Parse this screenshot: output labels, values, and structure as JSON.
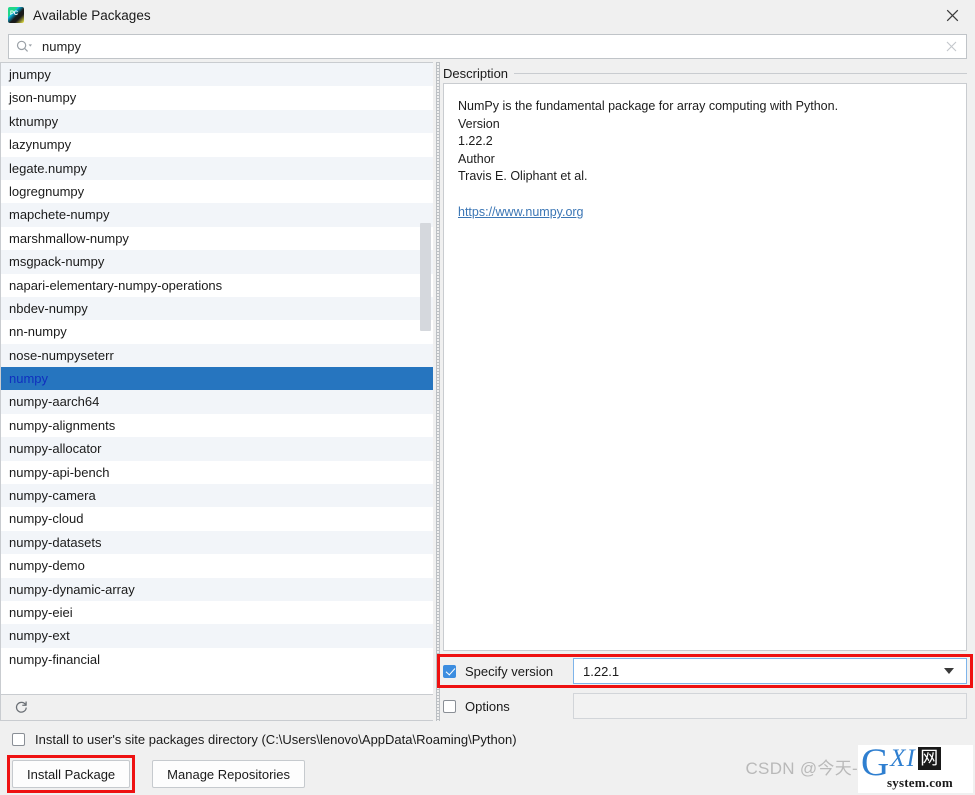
{
  "window": {
    "title": "Available Packages",
    "app_icon": "pycharm-icon",
    "close_icon": "close-icon"
  },
  "search": {
    "value": "numpy",
    "placeholder": "",
    "icon": "search-icon",
    "clear_icon": "clear-icon"
  },
  "package_list": {
    "items": [
      "jnumpy",
      "json-numpy",
      "ktnumpy",
      "lazynumpy",
      "legate.numpy",
      "logregnumpy",
      "mapchete-numpy",
      "marshmallow-numpy",
      "msgpack-numpy",
      "napari-elementary-numpy-operations",
      "nbdev-numpy",
      "nn-numpy",
      "nose-numpyseterr",
      "numpy",
      "numpy-aarch64",
      "numpy-alignments",
      "numpy-allocator",
      "numpy-api-bench",
      "numpy-camera",
      "numpy-cloud",
      "numpy-datasets",
      "numpy-demo",
      "numpy-dynamic-array",
      "numpy-eiei",
      "numpy-ext",
      "numpy-financial"
    ],
    "selected_index": 13,
    "selected_value": "numpy",
    "refresh_icon": "refresh-icon",
    "scrollbar": "vertical-scrollbar"
  },
  "description": {
    "title": "Description",
    "summary": "NumPy is the fundamental package for array computing with Python.",
    "version_label": "Version",
    "version_value": "1.22.2",
    "author_label": "Author",
    "author_value": "Travis E. Oliphant et al.",
    "link": "https://www.numpy.org"
  },
  "specify_version": {
    "label": "Specify version",
    "checked": true,
    "value": "1.22.1",
    "dropdown_icon": "chevron-down-icon"
  },
  "options": {
    "label": "Options",
    "checked": false,
    "value": ""
  },
  "install_dir": {
    "label": "Install to user's site packages directory (C:\\Users\\lenovo\\AppData\\Roaming\\Python)",
    "checked": false
  },
  "buttons": {
    "install": "Install Package",
    "manage": "Manage Repositories"
  },
  "watermarks": {
    "csdn": "CSDN @今天-",
    "logo_g": "G",
    "logo_xi": "XI",
    "logo_wang": "网",
    "logo_sub": "system.com"
  },
  "colors": {
    "selection_bg": "#2675bf",
    "selection_text": "#0f2fbf",
    "link": "#3b76b5",
    "annotation_red": "#ee1111",
    "checkbox_accent": "#3c8de0",
    "focus_border": "#7eb4ea"
  }
}
